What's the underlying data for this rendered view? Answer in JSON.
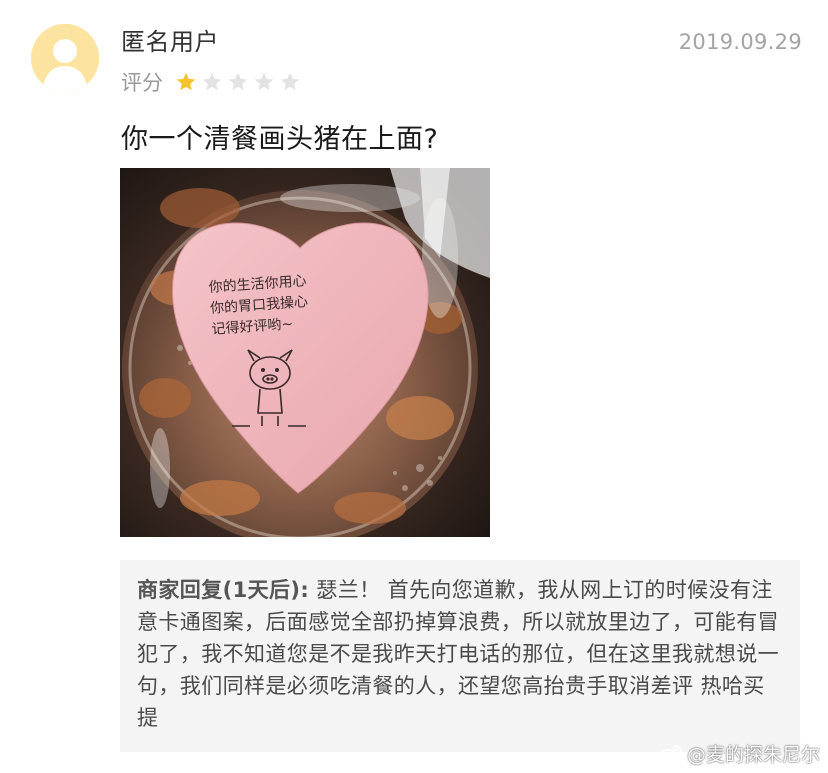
{
  "review": {
    "username": "匿名用户",
    "date": "2019.09.29",
    "rating_label": "评分",
    "rating": {
      "value": 1,
      "max": 5
    },
    "text": "你一个清餐画头猪在上面?",
    "photo": {
      "note_lines": [
        "你的生活你用心",
        "你的胃口我操心",
        "记得好评哟~"
      ]
    }
  },
  "merchant_reply": {
    "label": "商家回复(1天后):",
    "text": " 瑟兰！ 首先向您道歉，我从网上订的时候没有注意卡通图案，后面感觉全部扔掉算浪费，所以就放里边了，可能有冒犯了，我不知道您是不是我昨天打电话的那位，但在这里我就想说一句，我们同样是必须吃清餐的人，还望您高抬贵手取消差评 热哈买提"
  },
  "watermark": {
    "text": "@麦的探朱尼尔"
  },
  "colors": {
    "star_filled": "#f7c22f",
    "star_empty": "#e3e3e3",
    "avatar_bg": "#fde3a0",
    "reply_bg": "#f4f4f4"
  }
}
